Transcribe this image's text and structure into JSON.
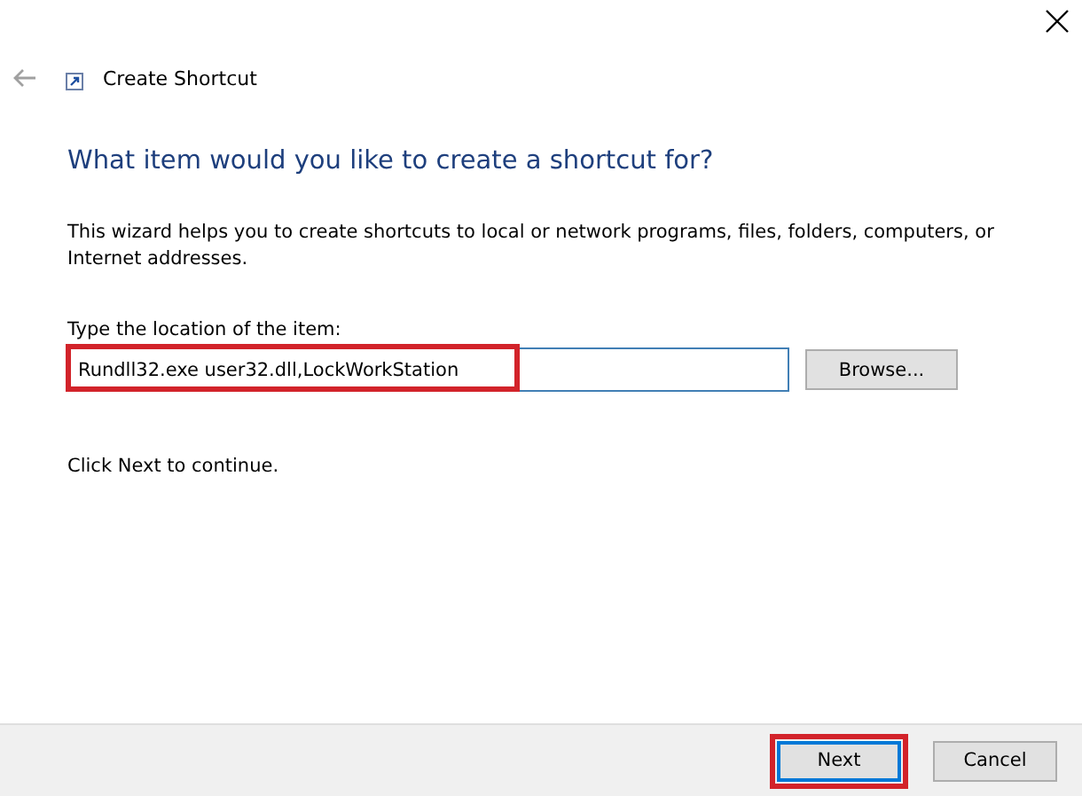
{
  "window": {
    "title": "Create Shortcut"
  },
  "heading": "What item would you like to create a shortcut for?",
  "description": "This wizard helps you to create shortcuts to local or network programs, files, folders, computers, or Internet addresses.",
  "location": {
    "label": "Type the location of the item:",
    "value": "Rundll32.exe user32.dll,LockWorkStation",
    "highlighted": true
  },
  "browse_button": "Browse...",
  "hint": "Click Next to continue.",
  "buttons": [
    {
      "label": "Next",
      "default": true,
      "highlighted": true
    },
    {
      "label": "Cancel",
      "default": false,
      "highlighted": false
    }
  ]
}
